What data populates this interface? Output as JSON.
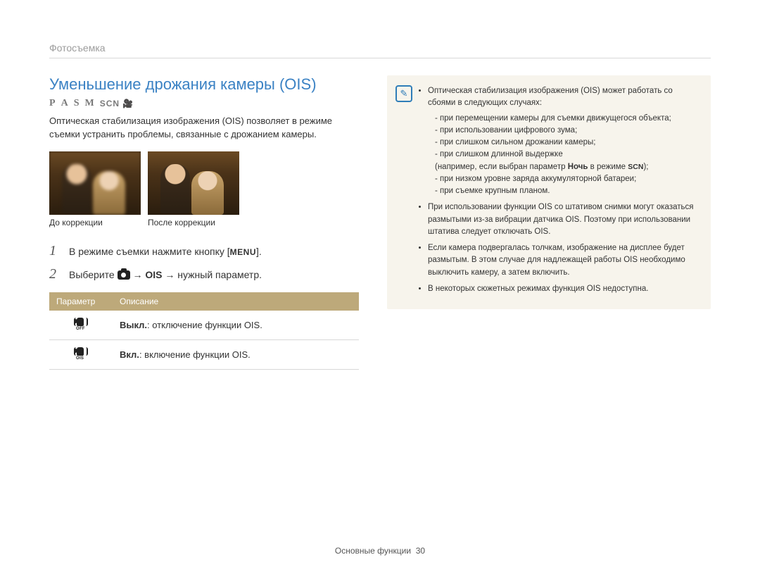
{
  "breadcrumb": "Фотосъемка",
  "title": "Уменьшение дрожания камеры (OIS)",
  "modes": {
    "p": "P",
    "a": "A",
    "s": "S",
    "m": "M",
    "scn": "SCN",
    "video_glyph": "🎥"
  },
  "intro": "Оптическая стабилизация изображения (OIS) позволяет в режиме съемки устранить проблемы, связанные с дрожанием камеры.",
  "captions": {
    "before": "До коррекции",
    "after": "После коррекции"
  },
  "steps": [
    {
      "num": "1",
      "prefix": "В режиме съемки нажмите кнопку [",
      "menu": "MENU",
      "suffix": "]."
    },
    {
      "num": "2",
      "prefix": "Выберите ",
      "mid": " → ",
      "bold": "OIS",
      "suffix2": " → нужный параметр."
    }
  ],
  "table": {
    "headers": {
      "param": "Параметр",
      "desc": "Описание"
    },
    "rows": [
      {
        "icon_sub": "OFF",
        "bold": "Выкл.",
        "rest": ": отключение функции OIS."
      },
      {
        "icon_sub": "OIS",
        "bold": "Вкл.",
        "rest": ": включение функции OIS."
      }
    ]
  },
  "notice": {
    "icon_glyph": "✎",
    "b1": "Оптическая стабилизация изображения (OIS) может работать со сбоями в следующих случаях:",
    "sub": [
      "при перемещении камеры для съемки движущегося объекта;",
      "при использовании цифрового зума;",
      "при слишком сильном дрожании камеры;",
      "при слишком длинной выдержке"
    ],
    "sub_extra_prefix": "(например, если выбран параметр ",
    "sub_extra_bold": "Ночь",
    "sub_extra_mid": " в режиме ",
    "sub_extra_scn": "SCN",
    "sub_extra_suffix": ");",
    "sub2": [
      "при низком уровне заряда аккумуляторной батареи;",
      "при съемке крупным планом."
    ],
    "b2": "При использовании функции OIS со штативом снимки могут оказаться размытыми из-за вибрации датчика OIS. Поэтому при использовании штатива следует отключать OIS.",
    "b3": "Если камера подвергалась толчкам, изображение на дисплее будет размытым. В этом случае для надлежащей работы OIS необходимо выключить камеру, а затем включить.",
    "b4": "В некоторых сюжетных режимах функция OIS недоступна."
  },
  "footer": {
    "section": "Основные функции",
    "page": "30"
  }
}
